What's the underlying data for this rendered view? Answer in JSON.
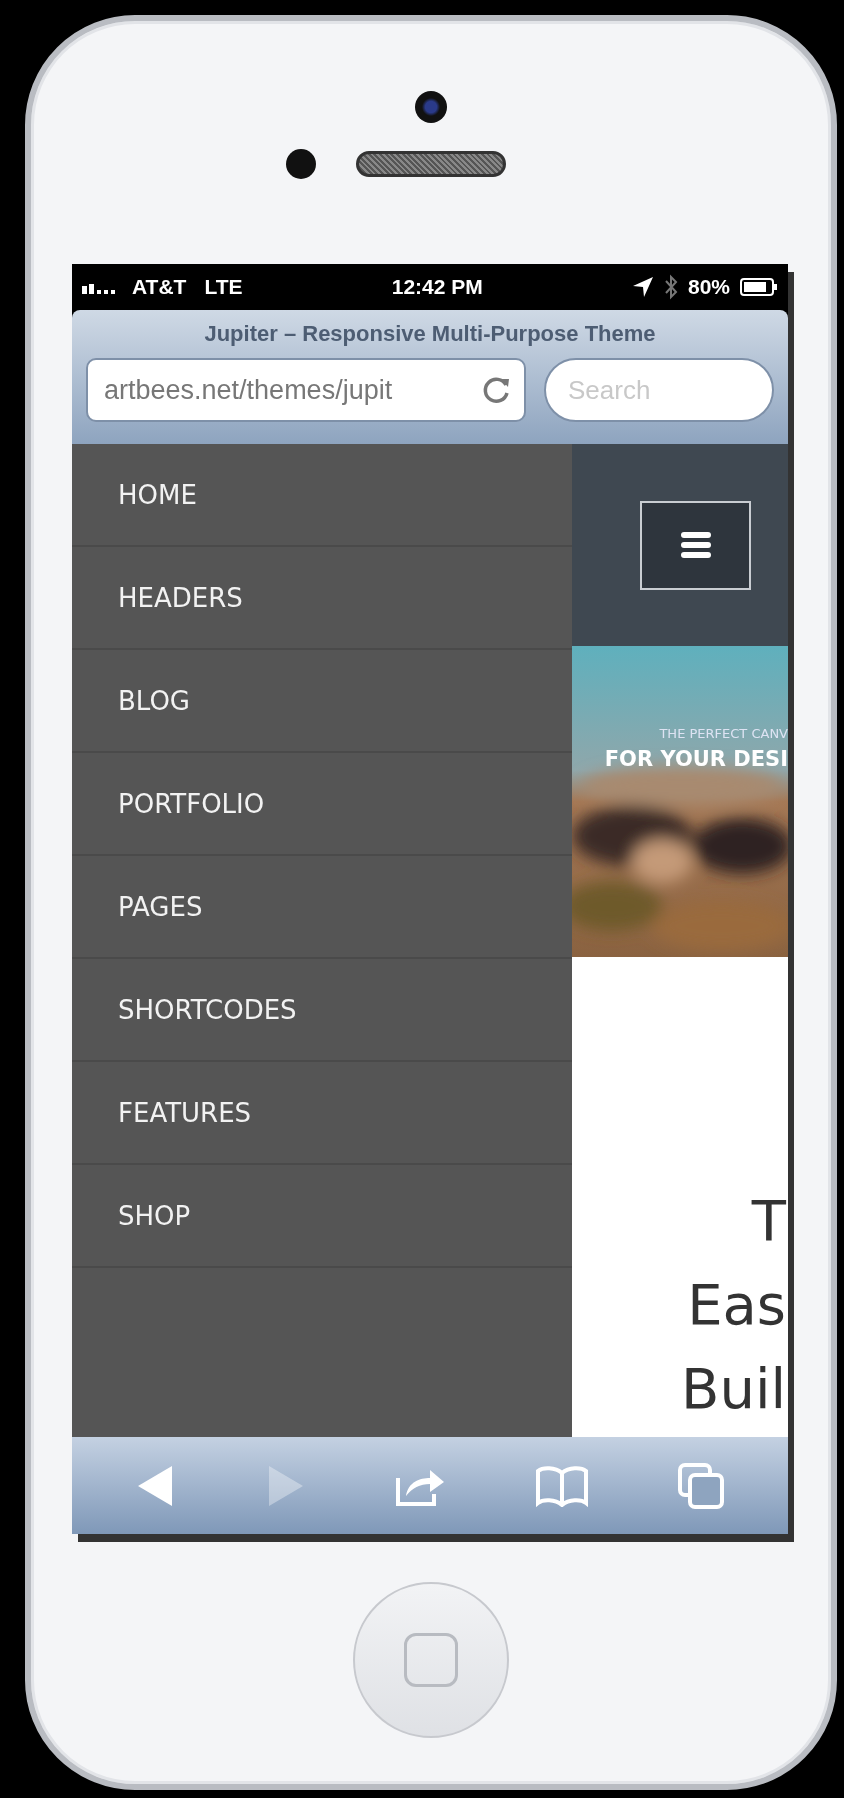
{
  "status_bar": {
    "carrier": "AT&T",
    "network": "LTE",
    "time": "12:42 PM",
    "battery": "80%"
  },
  "browser": {
    "title": "Jupiter – Responsive Multi-Purpose Theme",
    "url": "artbees.net/themes/jupit",
    "search": {
      "placeholder": "Search"
    }
  },
  "menu": {
    "items": [
      {
        "label": "HOME"
      },
      {
        "label": "HEADERS"
      },
      {
        "label": "BLOG"
      },
      {
        "label": "PORTFOLIO"
      },
      {
        "label": "PAGES"
      },
      {
        "label": "SHORTCODES"
      },
      {
        "label": "FEATURES"
      },
      {
        "label": "SHOP"
      }
    ]
  },
  "page": {
    "hero": {
      "kind": "picture",
      "eyebrow": "THE PERFECT CANV",
      "headline": "FOR YOUR DESI"
    },
    "heading_lines": [
      "T",
      "Eas",
      "Buil"
    ]
  },
  "toolbar": [
    {
      "kind": "back",
      "disabled": false
    },
    {
      "kind": "forward",
      "disabled": true
    },
    {
      "kind": "share",
      "disabled": false
    },
    {
      "kind": "bookmarks",
      "disabled": false
    },
    {
      "kind": "tabs",
      "disabled": false
    }
  ]
}
